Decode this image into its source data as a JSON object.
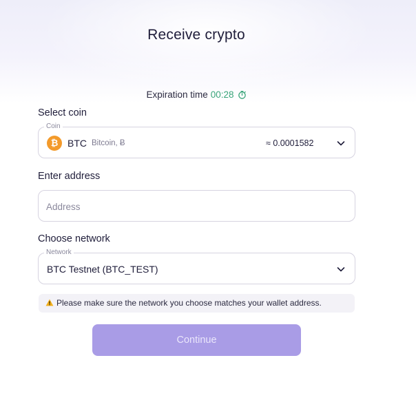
{
  "header": {
    "title": "Receive crypto"
  },
  "expiration": {
    "label": "Expiration time",
    "time": "00:28",
    "icon": "timer-icon"
  },
  "coin_section": {
    "label": "Select coin",
    "legend": "Coin",
    "symbol": "BTC",
    "name": "Bitcoin, Ƀ",
    "amount": "≈ 0.0001582",
    "icon": "bitcoin-icon",
    "icon_glyph": "₿",
    "icon_color": "#f39a2b"
  },
  "address_section": {
    "label": "Enter address",
    "placeholder": "Address",
    "value": ""
  },
  "network_section": {
    "label": "Choose network",
    "legend": "Network",
    "value": "BTC Testnet (BTC_TEST)"
  },
  "warning": {
    "icon": "warning-icon",
    "text": "Please make sure the network you choose matches your wallet address."
  },
  "continue_button": {
    "label": "Continue",
    "color": "#a99ce6"
  }
}
